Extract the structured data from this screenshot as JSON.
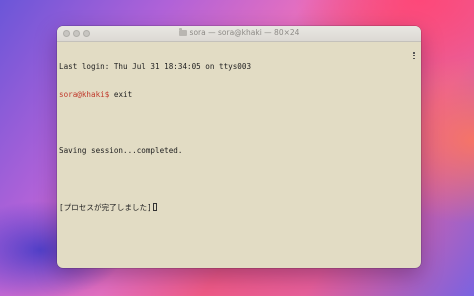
{
  "window": {
    "title": "sora — sora@khaki — 80×24",
    "title_icon": "folder-icon"
  },
  "terminal": {
    "lines": [
      {
        "text": "Last login: Thu Jul 31 18:34:05 on ttys003"
      },
      {
        "prompt": "sora@khaki$",
        "command": " exit"
      },
      {
        "text": ""
      },
      {
        "text": "Saving session...completed."
      },
      {
        "text": ""
      },
      {
        "text": "[プロセスが完了しました]"
      }
    ]
  },
  "colors": {
    "terminal_background": "#e2dcc4",
    "prompt": "#c0392b",
    "text": "#222222"
  }
}
